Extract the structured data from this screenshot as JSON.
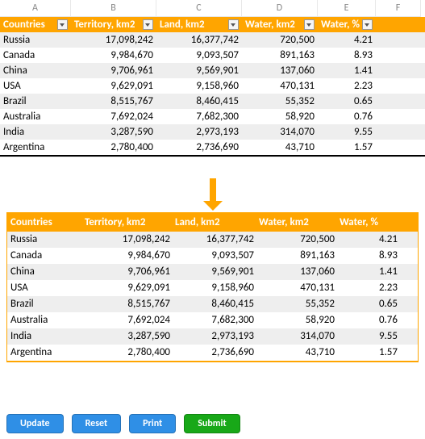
{
  "columns": [
    "A",
    "B",
    "C",
    "D",
    "E",
    "F"
  ],
  "headers": {
    "countries": "Countries",
    "territory": "Territory, km2",
    "land": "Land, km2",
    "water": "Water, km2",
    "waterpct": "Water, %"
  },
  "rows": [
    {
      "country": "Russia",
      "territory": "17,098,242",
      "land": "16,377,742",
      "water": "720,500",
      "pct": "4.21",
      "alt": true
    },
    {
      "country": "Canada",
      "territory": "9,984,670",
      "land": "9,093,507",
      "water": "891,163",
      "pct": "8.93",
      "alt": false
    },
    {
      "country": "China",
      "territory": "9,706,961",
      "land": "9,569,901",
      "water": "137,060",
      "pct": "1.41",
      "alt": true
    },
    {
      "country": "USA",
      "territory": "9,629,091",
      "land": "9,158,960",
      "water": "470,131",
      "pct": "2.23",
      "alt": false
    },
    {
      "country": "Brazil",
      "territory": "8,515,767",
      "land": "8,460,415",
      "water": "55,352",
      "pct": "0.65",
      "alt": true
    },
    {
      "country": "Australia",
      "territory": "7,692,024",
      "land": "7,682,300",
      "water": "58,920",
      "pct": "0.76",
      "alt": false
    },
    {
      "country": "India",
      "territory": "3,287,590",
      "land": "2,973,193",
      "water": "314,070",
      "pct": "9.55",
      "alt": true
    },
    {
      "country": "Argentina",
      "territory": "2,780,400",
      "land": "2,736,690",
      "water": "43,710",
      "pct": "1.57",
      "alt": false
    }
  ],
  "buttons": {
    "update": "Update",
    "reset": "Reset",
    "print": "Print",
    "submit": "Submit"
  }
}
